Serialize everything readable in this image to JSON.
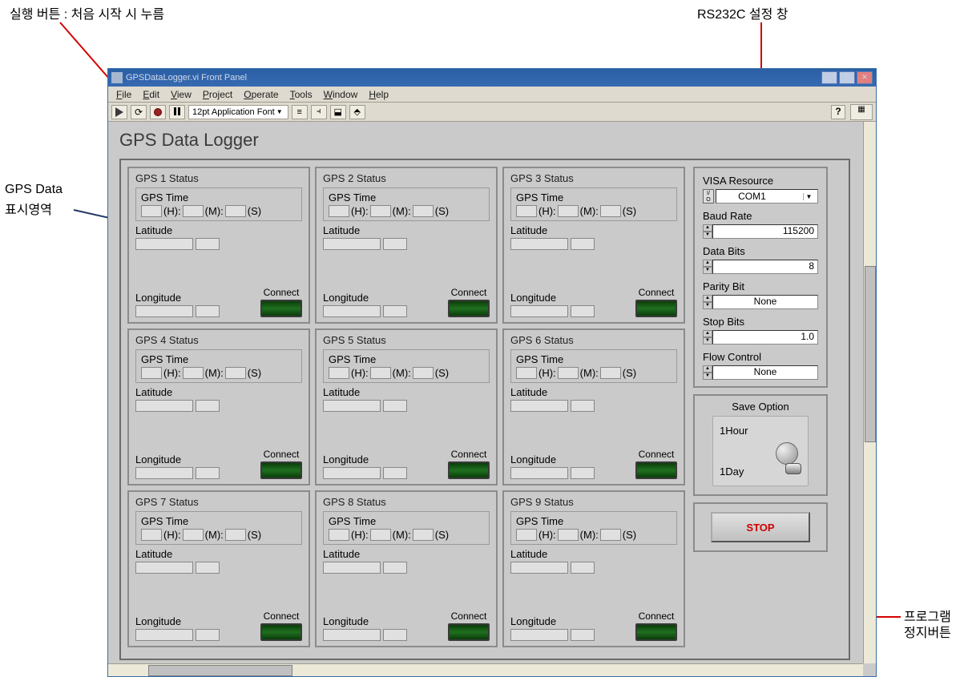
{
  "annotations": {
    "run_button": "실행 버튼 : 처음 시작 시 누름",
    "rs232c": "RS232C 설정 창",
    "gps_data_area_1": "GPS Data",
    "gps_data_area_2": "표시영역",
    "stop_button_1": "프로그램",
    "stop_button_2": "정지버튼"
  },
  "window": {
    "title": "GPSDataLogger.vi Front Panel"
  },
  "menu": {
    "file": "File",
    "edit": "Edit",
    "view": "View",
    "project": "Project",
    "operate": "Operate",
    "tools": "Tools",
    "window": "Window",
    "help": "Help"
  },
  "toolbar": {
    "font": "12pt Application Font"
  },
  "panel": {
    "title": "GPS Data Logger"
  },
  "gps": {
    "cells": [
      {
        "title": "GPS 1 Status"
      },
      {
        "title": "GPS 2 Status"
      },
      {
        "title": "GPS 3 Status"
      },
      {
        "title": "GPS 4 Status"
      },
      {
        "title": "GPS 5 Status"
      },
      {
        "title": "GPS 6 Status"
      },
      {
        "title": "GPS 7 Status"
      },
      {
        "title": "GPS 8 Status"
      },
      {
        "title": "GPS 9 Status"
      }
    ],
    "labels": {
      "gps_time": "GPS Time",
      "h": "(H):",
      "m": "(M):",
      "s": "(S)",
      "latitude": "Latitude",
      "longitude": "Longitude",
      "connect": "Connect"
    }
  },
  "serial": {
    "visa_label": "VISA Resource",
    "visa_value": "COM1",
    "baud_label": "Baud Rate",
    "baud_value": "115200",
    "databits_label": "Data Bits",
    "databits_value": "8",
    "parity_label": "Parity Bit",
    "parity_value": "None",
    "stopbits_label": "Stop Bits",
    "stopbits_value": "1.0",
    "flow_label": "Flow Control",
    "flow_value": "None"
  },
  "save": {
    "title": "Save Option",
    "opt1": "1Hour",
    "opt2": "1Day"
  },
  "stop": {
    "label": "STOP"
  }
}
